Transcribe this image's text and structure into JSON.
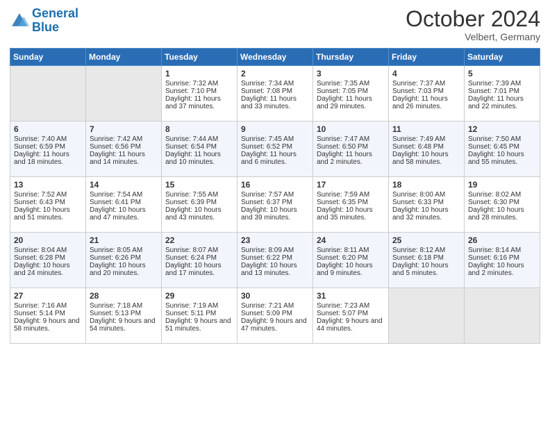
{
  "header": {
    "logo_general": "General",
    "logo_blue": "Blue",
    "month_title": "October 2024",
    "location": "Velbert, Germany"
  },
  "days_of_week": [
    "Sunday",
    "Monday",
    "Tuesday",
    "Wednesday",
    "Thursday",
    "Friday",
    "Saturday"
  ],
  "weeks": [
    [
      {
        "day": "",
        "sunrise": "",
        "sunset": "",
        "daylight": "",
        "empty": true
      },
      {
        "day": "",
        "sunrise": "",
        "sunset": "",
        "daylight": "",
        "empty": true
      },
      {
        "day": "1",
        "sunrise": "Sunrise: 7:32 AM",
        "sunset": "Sunset: 7:10 PM",
        "daylight": "Daylight: 11 hours and 37 minutes.",
        "empty": false
      },
      {
        "day": "2",
        "sunrise": "Sunrise: 7:34 AM",
        "sunset": "Sunset: 7:08 PM",
        "daylight": "Daylight: 11 hours and 33 minutes.",
        "empty": false
      },
      {
        "day": "3",
        "sunrise": "Sunrise: 7:35 AM",
        "sunset": "Sunset: 7:05 PM",
        "daylight": "Daylight: 11 hours and 29 minutes.",
        "empty": false
      },
      {
        "day": "4",
        "sunrise": "Sunrise: 7:37 AM",
        "sunset": "Sunset: 7:03 PM",
        "daylight": "Daylight: 11 hours and 26 minutes.",
        "empty": false
      },
      {
        "day": "5",
        "sunrise": "Sunrise: 7:39 AM",
        "sunset": "Sunset: 7:01 PM",
        "daylight": "Daylight: 11 hours and 22 minutes.",
        "empty": false
      }
    ],
    [
      {
        "day": "6",
        "sunrise": "Sunrise: 7:40 AM",
        "sunset": "Sunset: 6:59 PM",
        "daylight": "Daylight: 11 hours and 18 minutes.",
        "empty": false
      },
      {
        "day": "7",
        "sunrise": "Sunrise: 7:42 AM",
        "sunset": "Sunset: 6:56 PM",
        "daylight": "Daylight: 11 hours and 14 minutes.",
        "empty": false
      },
      {
        "day": "8",
        "sunrise": "Sunrise: 7:44 AM",
        "sunset": "Sunset: 6:54 PM",
        "daylight": "Daylight: 11 hours and 10 minutes.",
        "empty": false
      },
      {
        "day": "9",
        "sunrise": "Sunrise: 7:45 AM",
        "sunset": "Sunset: 6:52 PM",
        "daylight": "Daylight: 11 hours and 6 minutes.",
        "empty": false
      },
      {
        "day": "10",
        "sunrise": "Sunrise: 7:47 AM",
        "sunset": "Sunset: 6:50 PM",
        "daylight": "Daylight: 11 hours and 2 minutes.",
        "empty": false
      },
      {
        "day": "11",
        "sunrise": "Sunrise: 7:49 AM",
        "sunset": "Sunset: 6:48 PM",
        "daylight": "Daylight: 10 hours and 58 minutes.",
        "empty": false
      },
      {
        "day": "12",
        "sunrise": "Sunrise: 7:50 AM",
        "sunset": "Sunset: 6:45 PM",
        "daylight": "Daylight: 10 hours and 55 minutes.",
        "empty": false
      }
    ],
    [
      {
        "day": "13",
        "sunrise": "Sunrise: 7:52 AM",
        "sunset": "Sunset: 6:43 PM",
        "daylight": "Daylight: 10 hours and 51 minutes.",
        "empty": false
      },
      {
        "day": "14",
        "sunrise": "Sunrise: 7:54 AM",
        "sunset": "Sunset: 6:41 PM",
        "daylight": "Daylight: 10 hours and 47 minutes.",
        "empty": false
      },
      {
        "day": "15",
        "sunrise": "Sunrise: 7:55 AM",
        "sunset": "Sunset: 6:39 PM",
        "daylight": "Daylight: 10 hours and 43 minutes.",
        "empty": false
      },
      {
        "day": "16",
        "sunrise": "Sunrise: 7:57 AM",
        "sunset": "Sunset: 6:37 PM",
        "daylight": "Daylight: 10 hours and 39 minutes.",
        "empty": false
      },
      {
        "day": "17",
        "sunrise": "Sunrise: 7:59 AM",
        "sunset": "Sunset: 6:35 PM",
        "daylight": "Daylight: 10 hours and 35 minutes.",
        "empty": false
      },
      {
        "day": "18",
        "sunrise": "Sunrise: 8:00 AM",
        "sunset": "Sunset: 6:33 PM",
        "daylight": "Daylight: 10 hours and 32 minutes.",
        "empty": false
      },
      {
        "day": "19",
        "sunrise": "Sunrise: 8:02 AM",
        "sunset": "Sunset: 6:30 PM",
        "daylight": "Daylight: 10 hours and 28 minutes.",
        "empty": false
      }
    ],
    [
      {
        "day": "20",
        "sunrise": "Sunrise: 8:04 AM",
        "sunset": "Sunset: 6:28 PM",
        "daylight": "Daylight: 10 hours and 24 minutes.",
        "empty": false
      },
      {
        "day": "21",
        "sunrise": "Sunrise: 8:05 AM",
        "sunset": "Sunset: 6:26 PM",
        "daylight": "Daylight: 10 hours and 20 minutes.",
        "empty": false
      },
      {
        "day": "22",
        "sunrise": "Sunrise: 8:07 AM",
        "sunset": "Sunset: 6:24 PM",
        "daylight": "Daylight: 10 hours and 17 minutes.",
        "empty": false
      },
      {
        "day": "23",
        "sunrise": "Sunrise: 8:09 AM",
        "sunset": "Sunset: 6:22 PM",
        "daylight": "Daylight: 10 hours and 13 minutes.",
        "empty": false
      },
      {
        "day": "24",
        "sunrise": "Sunrise: 8:11 AM",
        "sunset": "Sunset: 6:20 PM",
        "daylight": "Daylight: 10 hours and 9 minutes.",
        "empty": false
      },
      {
        "day": "25",
        "sunrise": "Sunrise: 8:12 AM",
        "sunset": "Sunset: 6:18 PM",
        "daylight": "Daylight: 10 hours and 5 minutes.",
        "empty": false
      },
      {
        "day": "26",
        "sunrise": "Sunrise: 8:14 AM",
        "sunset": "Sunset: 6:16 PM",
        "daylight": "Daylight: 10 hours and 2 minutes.",
        "empty": false
      }
    ],
    [
      {
        "day": "27",
        "sunrise": "Sunrise: 7:16 AM",
        "sunset": "Sunset: 5:14 PM",
        "daylight": "Daylight: 9 hours and 58 minutes.",
        "empty": false
      },
      {
        "day": "28",
        "sunrise": "Sunrise: 7:18 AM",
        "sunset": "Sunset: 5:13 PM",
        "daylight": "Daylight: 9 hours and 54 minutes.",
        "empty": false
      },
      {
        "day": "29",
        "sunrise": "Sunrise: 7:19 AM",
        "sunset": "Sunset: 5:11 PM",
        "daylight": "Daylight: 9 hours and 51 minutes.",
        "empty": false
      },
      {
        "day": "30",
        "sunrise": "Sunrise: 7:21 AM",
        "sunset": "Sunset: 5:09 PM",
        "daylight": "Daylight: 9 hours and 47 minutes.",
        "empty": false
      },
      {
        "day": "31",
        "sunrise": "Sunrise: 7:23 AM",
        "sunset": "Sunset: 5:07 PM",
        "daylight": "Daylight: 9 hours and 44 minutes.",
        "empty": false
      },
      {
        "day": "",
        "sunrise": "",
        "sunset": "",
        "daylight": "",
        "empty": true
      },
      {
        "day": "",
        "sunrise": "",
        "sunset": "",
        "daylight": "",
        "empty": true
      }
    ]
  ]
}
